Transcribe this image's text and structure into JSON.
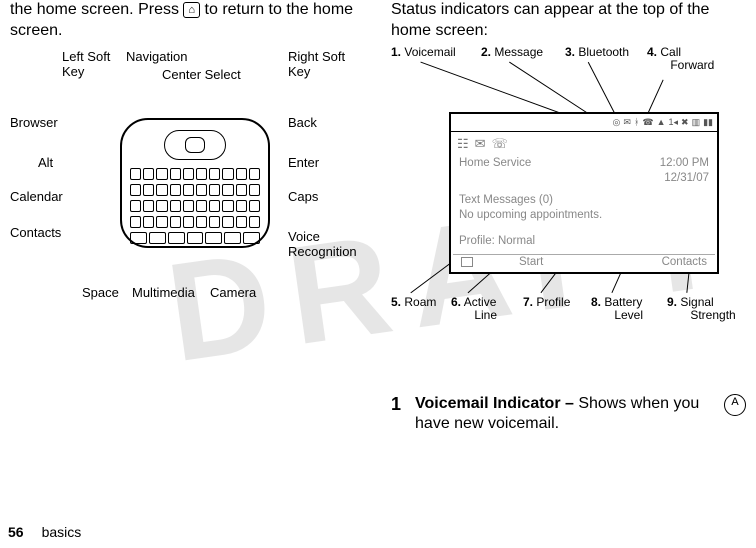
{
  "draft_watermark": "DRAFT",
  "left": {
    "intro_pre": "the home screen. Press ",
    "intro_key_glyph": "⌂",
    "intro_post": " to return to the home screen.",
    "labels": {
      "left_soft_key": "Left Soft\nKey",
      "navigation": "Navigation",
      "center_select": "Center Select",
      "right_soft_key": "Right Soft\nKey",
      "browser": "Browser",
      "back": "Back",
      "alt": "Alt",
      "enter": "Enter",
      "calendar": "Calendar",
      "caps": "Caps",
      "contacts": "Contacts",
      "voice_recognition": "Voice\nRecognition",
      "space": "Space",
      "multimedia": "Multimedia",
      "camera": "Camera"
    }
  },
  "right": {
    "intro": "Status indicators can appear at the top of the home screen:",
    "top_labels": {
      "voicemail": {
        "n": "1.",
        "t": " Voicemail"
      },
      "message": {
        "n": "2.",
        "t": " Message"
      },
      "bluetooth": {
        "n": "3.",
        "t": " Bluetooth"
      },
      "call_forward": {
        "n": "4.",
        "t": " Call\n       Forward"
      }
    },
    "bottom_labels": {
      "roam": {
        "n": "5.",
        "t": " Roam"
      },
      "active_line": {
        "n": "6.",
        "t": " Active\n       Line"
      },
      "profile": {
        "n": "7.",
        "t": " Profile"
      },
      "battery": {
        "n": "8.",
        "t": " Battery\n       Level"
      },
      "signal": {
        "n": "9.",
        "t": " Signal\n       Strength"
      }
    },
    "screen": {
      "home_service": "Home Service",
      "time": "12:00 PM",
      "date": "12/31/07",
      "text_messages": "Text Messages (0)",
      "no_appt": "No upcoming appointments.",
      "profile": "Profile: Normal",
      "soft_start": "Start",
      "soft_contacts": "Contacts"
    },
    "voicemail_item": {
      "num": "1",
      "bold": "Voicemail Indicator –",
      "rest": " Shows when you have new voicemail.",
      "edge_glyph": "ᴬ"
    }
  },
  "footer": {
    "page": "56",
    "section": "basics"
  }
}
